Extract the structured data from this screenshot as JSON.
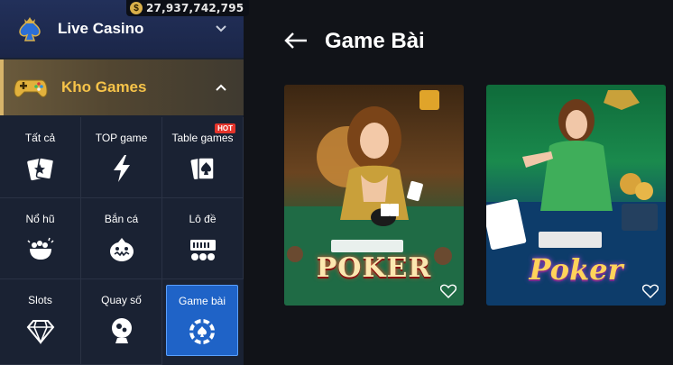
{
  "balance": {
    "currency_icon": "dollar-coin-icon",
    "value": "27,937,742,795"
  },
  "sidebar": {
    "live_casino": {
      "label": "Live Casino",
      "icon": "spade-crown-icon",
      "chevron": "chevron-down-icon"
    },
    "kho_games": {
      "label": "Kho Games",
      "icon": "gamepad-icon",
      "chevron": "chevron-up-icon",
      "accent": "#f6c349"
    },
    "categories": [
      {
        "label": "Tất cả",
        "icon": "cards-star-icon",
        "badge": ""
      },
      {
        "label": "TOP game",
        "icon": "lightning-icon",
        "badge": ""
      },
      {
        "label": "Table games",
        "icon": "spade-card-icon",
        "badge": "HOT"
      },
      {
        "label": "Nổ hũ",
        "icon": "jackpot-pot-icon",
        "badge": ""
      },
      {
        "label": "Bắn cá",
        "icon": "fish-icon",
        "badge": ""
      },
      {
        "label": "Lô đề",
        "icon": "lottery-ticket-icon",
        "badge": ""
      },
      {
        "label": "Slots",
        "icon": "diamond-icon",
        "badge": ""
      },
      {
        "label": "Quay số",
        "icon": "lottery-ball-icon",
        "badge": ""
      },
      {
        "label": "Game bài",
        "icon": "poker-chip-icon",
        "badge": "",
        "active": true
      }
    ]
  },
  "main": {
    "back_icon": "arrow-left-icon",
    "title": "Game Bài",
    "games": [
      {
        "art_text": "POKER",
        "favorite_icon": "heart-outline-icon"
      },
      {
        "art_text": "Poker",
        "favorite_icon": "heart-outline-icon"
      }
    ]
  },
  "colors": {
    "active_tab": "#1f63c7",
    "hot_badge": "#e4342b",
    "gold": "#d9b04a"
  }
}
